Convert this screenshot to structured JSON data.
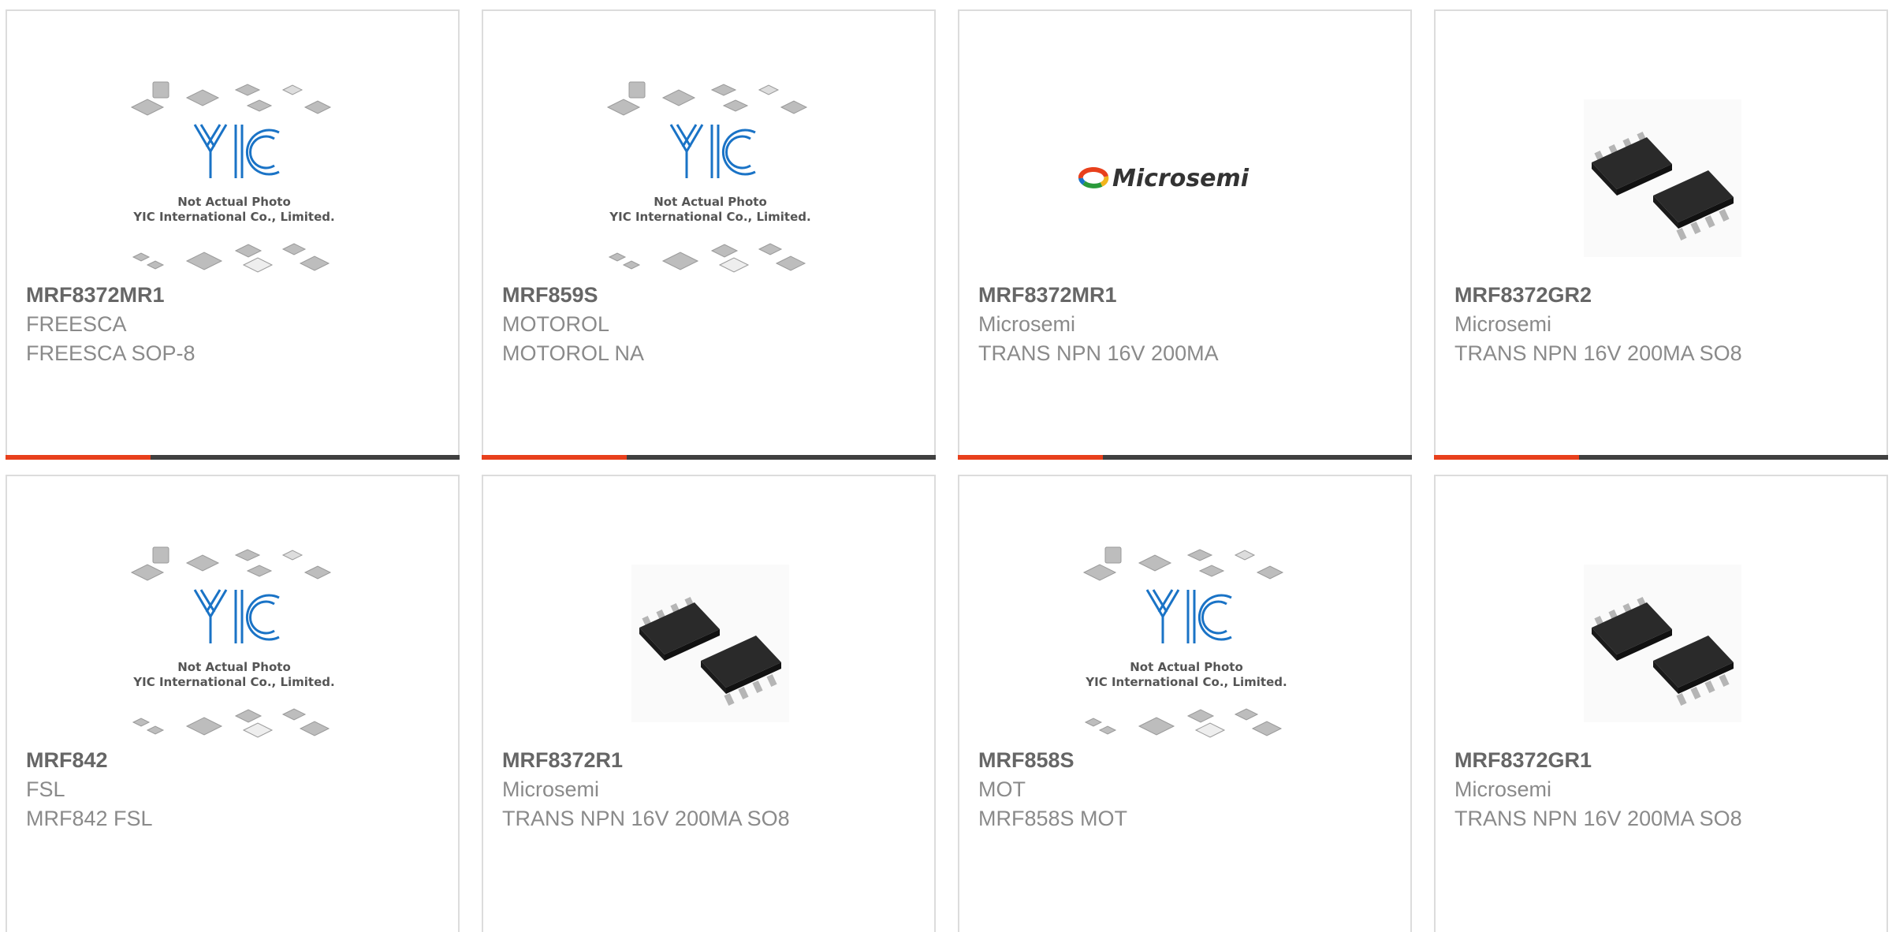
{
  "colors": {
    "accent": "#e8401c",
    "bar_dark": "#404040",
    "border": "#dcdcdc",
    "part_number": "#666666",
    "text_muted": "#8a8a8a",
    "yic_blue": "#1a73c6"
  },
  "placeholder_image": {
    "line1": "Not Actual Photo",
    "line2": "YIC International Co., Limited.",
    "logo_text": "YIC"
  },
  "microsemi_logo_text": "Microsemi",
  "products": [
    {
      "part_number": "MRF8372MR1",
      "manufacturer": "FREESCA",
      "description": "FREESCA SOP-8",
      "image": "yic-placeholder"
    },
    {
      "part_number": "MRF859S",
      "manufacturer": "MOTOROL",
      "description": "MOTOROL NA",
      "image": "yic-placeholder"
    },
    {
      "part_number": "MRF8372MR1",
      "manufacturer": "Microsemi",
      "description": "TRANS NPN 16V 200MA",
      "image": "microsemi-logo"
    },
    {
      "part_number": "MRF8372GR2",
      "manufacturer": "Microsemi",
      "description": "TRANS NPN 16V 200MA SO8",
      "image": "so8-chip-photo"
    },
    {
      "part_number": "MRF842",
      "manufacturer": "FSL",
      "description": "MRF842 FSL",
      "image": "yic-placeholder"
    },
    {
      "part_number": "MRF8372R1",
      "manufacturer": "Microsemi",
      "description": "TRANS NPN 16V 200MA SO8",
      "image": "so8-chip-photo"
    },
    {
      "part_number": "MRF858S",
      "manufacturer": "MOT",
      "description": "MRF858S MOT",
      "image": "yic-placeholder"
    },
    {
      "part_number": "MRF8372GR1",
      "manufacturer": "Microsemi",
      "description": "TRANS NPN 16V 200MA SO8",
      "image": "so8-chip-photo"
    }
  ]
}
